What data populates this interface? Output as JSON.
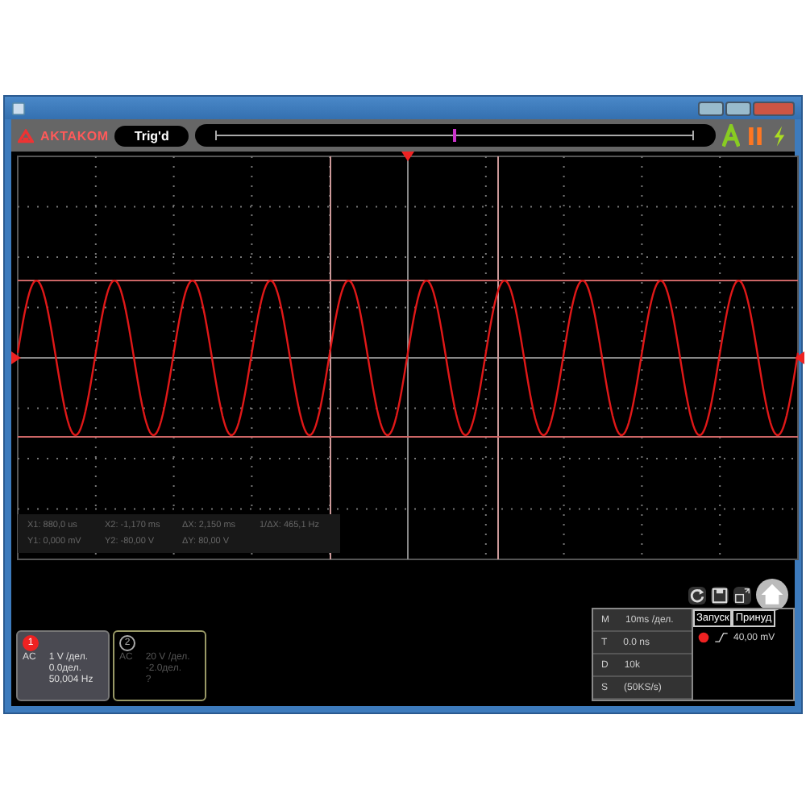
{
  "toolbar": {
    "logo": "AKTAKOM",
    "trigger_status": "Trig'd"
  },
  "cursor_readouts": [
    [
      "X1: 880,0 us",
      "X2: -1,170 ms",
      "ΔX: 2,150 ms",
      "1/ΔX: 465,1 Hz"
    ],
    [
      "Y1: 0,000 mV",
      "Y2: -80,00 V",
      "ΔY: 80,00 V"
    ]
  ],
  "channels": [
    {
      "number": "1",
      "coupling": "AC",
      "scale": "1 V /дел.",
      "offset": "0.0дел.",
      "reading": "50,004 Hz",
      "selected": true
    },
    {
      "number": "2",
      "coupling": "AC",
      "scale": "20 V /дел.",
      "offset": "-2.0дел.",
      "reading": "?",
      "selected": false
    }
  ],
  "settings": [
    {
      "label": "M",
      "value": "10ms /дел."
    },
    {
      "label": "T",
      "value": "0.0 ns"
    },
    {
      "label": "D",
      "value": "10k"
    },
    {
      "label": "S",
      "value": "(50KS/s)"
    }
  ],
  "trigger": {
    "buttons": [
      "Запуск",
      "Принуд"
    ],
    "level": "40,00 mV"
  }
}
